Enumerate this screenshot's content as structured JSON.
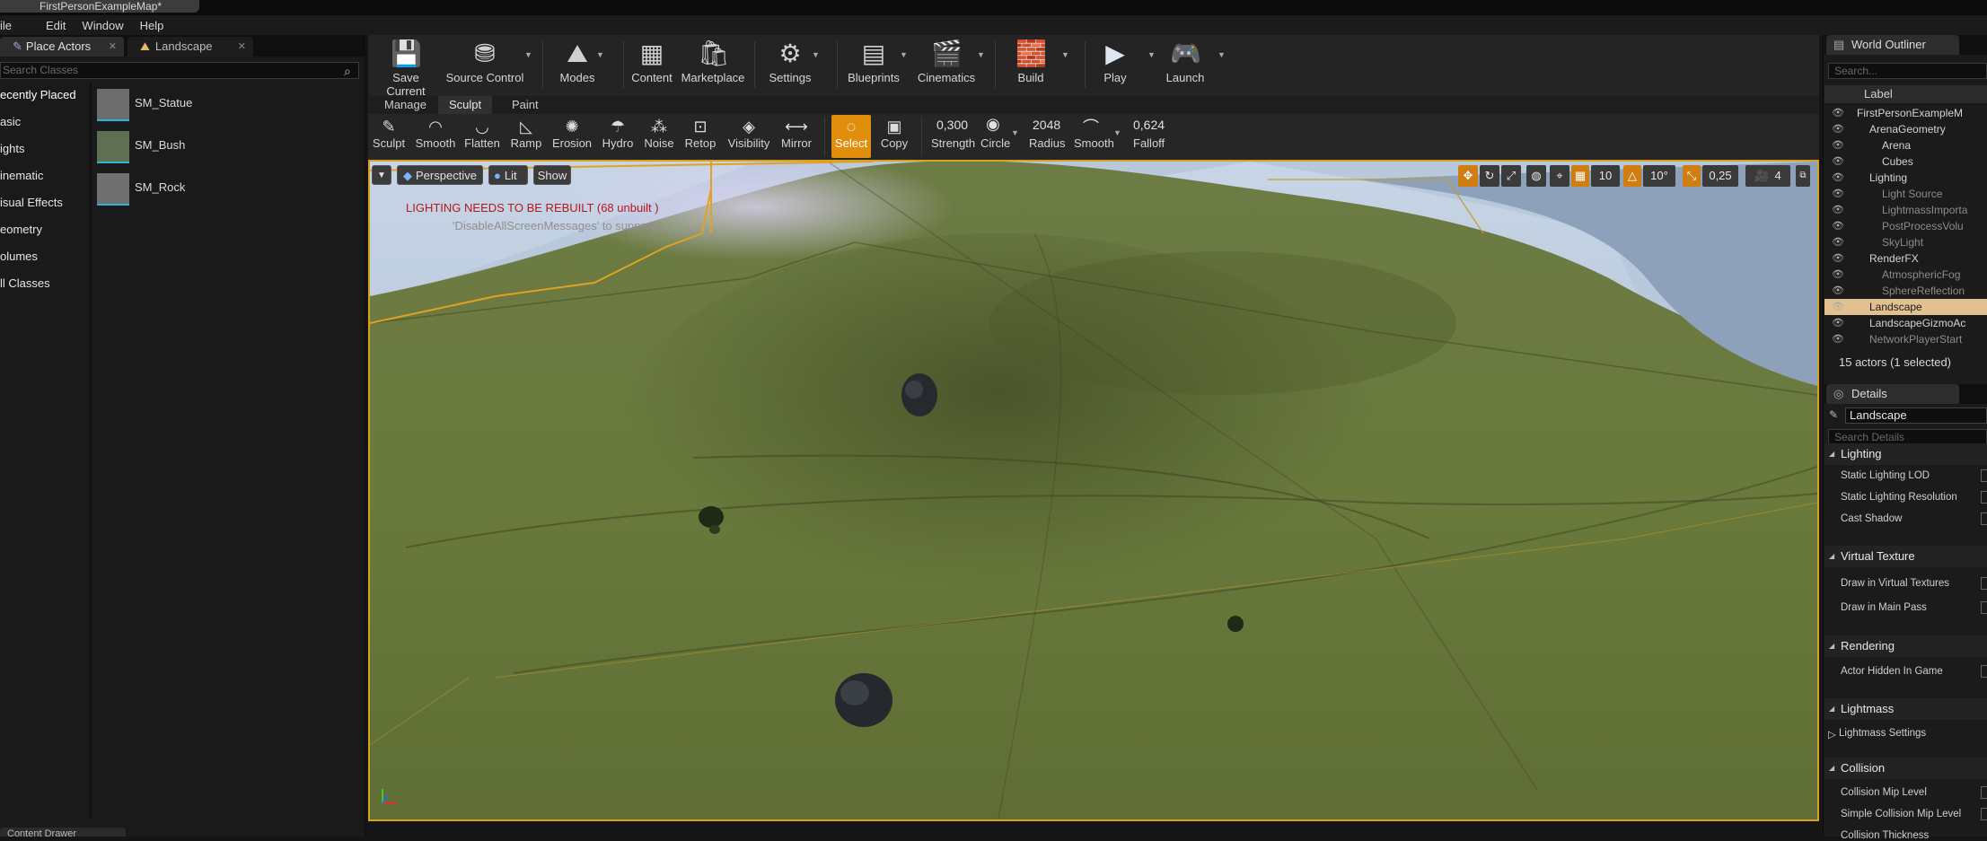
{
  "window": {
    "map_tab": "FirstPersonExampleMap*"
  },
  "menu": [
    "ile",
    "Edit",
    "Window",
    "Help"
  ],
  "left_panel": {
    "tab_place": "Place Actors",
    "tab_landscape": "Landscape",
    "search_placeholder": "Search Classes",
    "categories": [
      "ecently Placed",
      "asic",
      "ights",
      "inematic",
      "isual Effects",
      "eometry",
      "olumes",
      "ll Classes"
    ],
    "actors": [
      "SM_Statue",
      "SM_Bush",
      "SM_Rock"
    ]
  },
  "toolbar": [
    {
      "label": "Save Current",
      "icon": "save-icon"
    },
    {
      "label": "Source Control",
      "icon": "source-control-icon"
    },
    {
      "label": "Modes",
      "icon": "modes-icon"
    },
    {
      "label": "Content",
      "icon": "content-icon"
    },
    {
      "label": "Marketplace",
      "icon": "marketplace-icon"
    },
    {
      "label": "Settings",
      "icon": "settings-icon"
    },
    {
      "label": "Blueprints",
      "icon": "blueprints-icon"
    },
    {
      "label": "Cinematics",
      "icon": "cinematics-icon"
    },
    {
      "label": "Build",
      "icon": "build-icon"
    },
    {
      "label": "Play",
      "icon": "play-icon"
    },
    {
      "label": "Launch",
      "icon": "launch-icon"
    }
  ],
  "modes": {
    "tabs": [
      "Manage",
      "Sculpt",
      "Paint"
    ],
    "active": "Sculpt"
  },
  "tools": [
    {
      "label": "Sculpt",
      "icon": "sculpt-icon"
    },
    {
      "label": "Smooth",
      "icon": "smooth-icon"
    },
    {
      "label": "Flatten",
      "icon": "flatten-icon"
    },
    {
      "label": "Ramp",
      "icon": "ramp-icon"
    },
    {
      "label": "Erosion",
      "icon": "erosion-icon"
    },
    {
      "label": "Hydro",
      "icon": "hydro-icon"
    },
    {
      "label": "Noise",
      "icon": "noise-icon"
    },
    {
      "label": "Retop",
      "icon": "retop-icon"
    },
    {
      "label": "Visibility",
      "icon": "visibility-icon"
    },
    {
      "label": "Mirror",
      "icon": "mirror-icon"
    },
    {
      "label": "Select",
      "icon": "select-icon"
    },
    {
      "label": "Copy",
      "icon": "copy-icon"
    }
  ],
  "brush": {
    "strength_value": "0,300",
    "strength_label": "Strength",
    "circle_label": "Circle",
    "radius_value": "2048",
    "radius_label": "Radius",
    "smooth_label": "Smooth",
    "falloff_value": "0,624",
    "falloff_label": "Falloff"
  },
  "viewport": {
    "perspective": "Perspective",
    "lit": "Lit",
    "show": "Show",
    "lighting_warning": "LIGHTING NEEDS TO BE REBUILT (68 unbuilt )",
    "suppress_hint": "'DisableAllScreenMessages' to suppress",
    "grid_snap": "10",
    "rot_snap": "10°",
    "scale_snap": "0,25",
    "cam_speed": "4"
  },
  "outliner": {
    "tab": "World Outliner",
    "search_placeholder": "Search...",
    "column": "Label",
    "rows": [
      {
        "label": "FirstPersonExampleM",
        "indent": 0,
        "style": "normal"
      },
      {
        "label": "ArenaGeometry",
        "indent": 1,
        "style": "normal"
      },
      {
        "label": "Arena",
        "indent": 2,
        "style": "normal"
      },
      {
        "label": "Cubes",
        "indent": 2,
        "style": "normal"
      },
      {
        "label": "Lighting",
        "indent": 1,
        "style": "normal"
      },
      {
        "label": "Light Source",
        "indent": 2,
        "style": "dim"
      },
      {
        "label": "LightmassImporta",
        "indent": 2,
        "style": "dim"
      },
      {
        "label": "PostProcessVolu",
        "indent": 2,
        "style": "dim"
      },
      {
        "label": "SkyLight",
        "indent": 2,
        "style": "dim"
      },
      {
        "label": "RenderFX",
        "indent": 1,
        "style": "normal"
      },
      {
        "label": "AtmosphericFog",
        "indent": 2,
        "style": "dim"
      },
      {
        "label": "SphereReflection",
        "indent": 2,
        "style": "dim"
      },
      {
        "label": "Landscape",
        "indent": 1,
        "style": "selected"
      },
      {
        "label": "LandscapeGizmoAc",
        "indent": 1,
        "style": "normal"
      },
      {
        "label": "NetworkPlayerStart",
        "indent": 1,
        "style": "dim"
      }
    ],
    "actors_count": "15 actors (1 selected)"
  },
  "details": {
    "tab": "Details",
    "name": "Landscape",
    "search_placeholder": "Search Details",
    "sections": [
      {
        "title": "Lighting",
        "props": [
          "Static Lighting LOD",
          "Static Lighting Resolution",
          "Cast Shadow"
        ]
      },
      {
        "title": "Virtual Texture",
        "props": [
          "Draw in Virtual Textures",
          "Draw in Main Pass"
        ]
      },
      {
        "title": "Rendering",
        "props": [
          "Actor Hidden In Game"
        ]
      },
      {
        "title": "Lightmass",
        "props": [
          "Lightmass Settings"
        ]
      },
      {
        "title": "Collision",
        "props": [
          "Collision Mip Level",
          "Simple Collision Mip Level",
          "Collision Thickness"
        ]
      }
    ]
  },
  "bottom": {
    "content_drawer": "Content Drawer"
  },
  "colors": {
    "accent": "#e08e0b",
    "selection_border": "#d8a11f",
    "warning": "#b5171b",
    "selected_row": "#e3c090"
  }
}
